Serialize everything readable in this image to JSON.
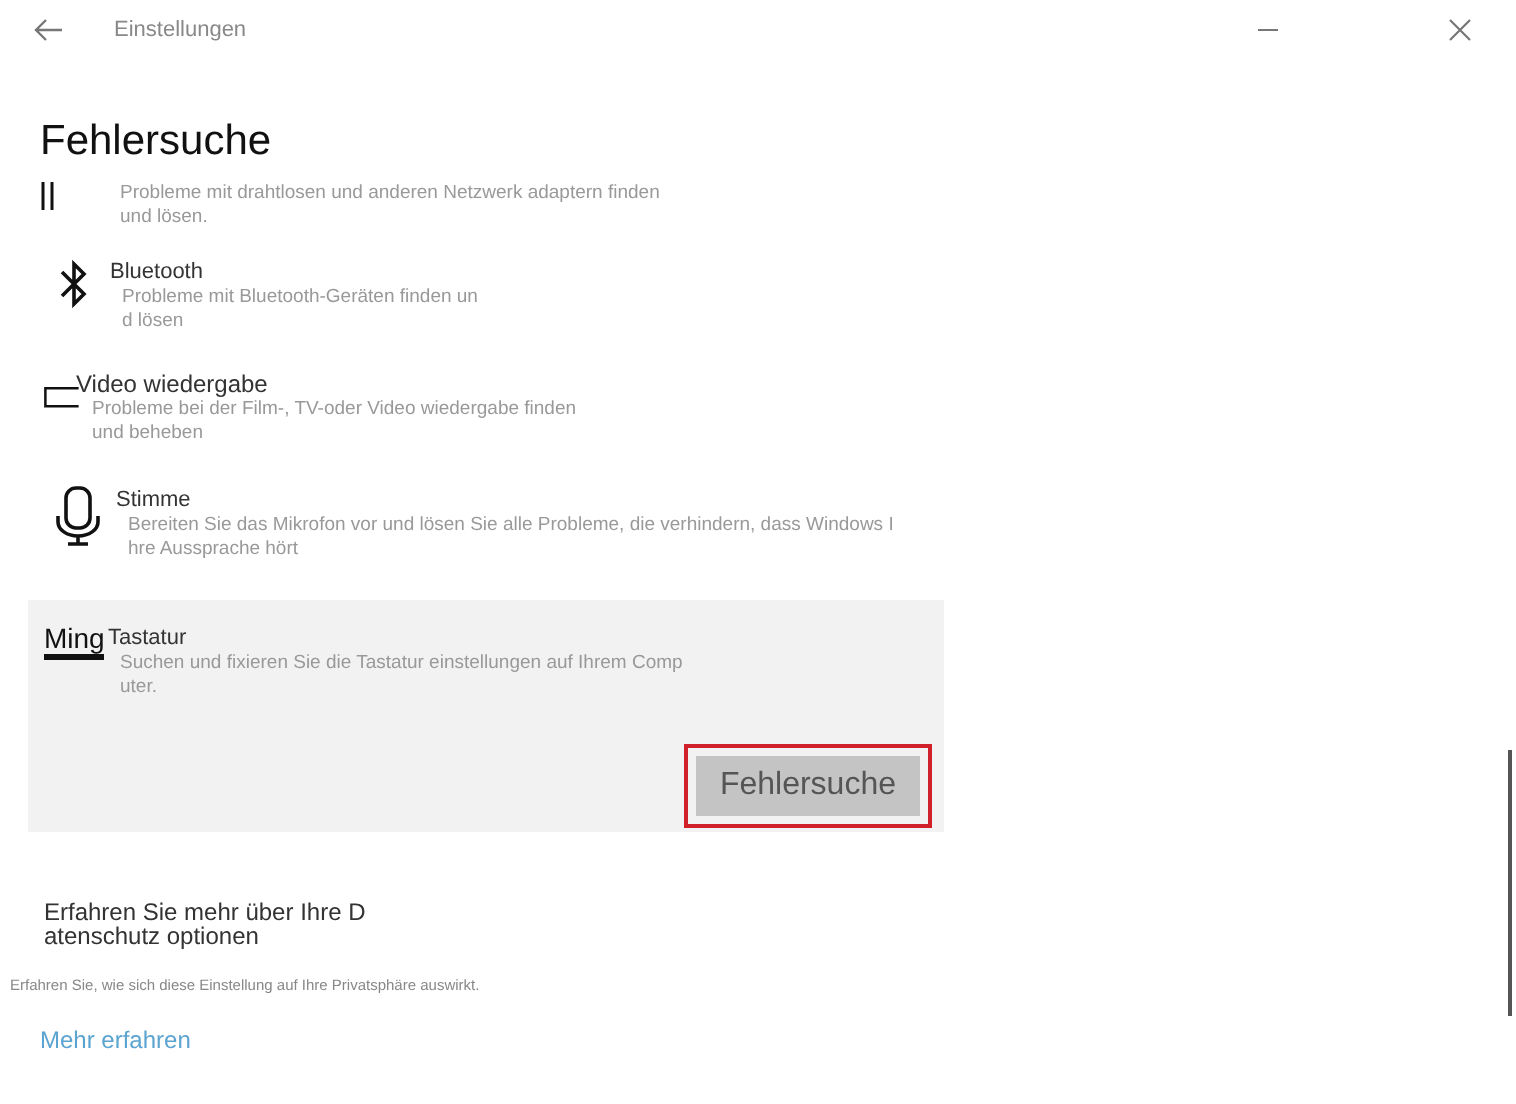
{
  "window": {
    "title": "Einstellungen"
  },
  "heading": "Fehlersuche",
  "items": [
    {
      "kind": "network",
      "description": [
        "Probleme mit drahtlosen und anderen Netzwerk adaptern finden",
        "und lösen."
      ],
      "expanded": false
    },
    {
      "kind": "bluetooth",
      "title": "Bluetooth",
      "description": [
        "Probleme mit Bluetooth-Geräten finden un",
        "d lösen"
      ],
      "expanded": false
    },
    {
      "kind": "video",
      "title": "Video wiedergabe",
      "description": [
        "Probleme bei der Film-, TV-oder Video wiedergabe finden",
        "und beheben"
      ],
      "expanded": false
    },
    {
      "kind": "microphone",
      "title": "Stimme",
      "description": [
        "Bereiten Sie das Mikrofon vor und lösen Sie alle Probleme, die verhindern, dass Windows I",
        "hre Aussprache hört"
      ],
      "expanded": false
    },
    {
      "kind": "keyboard",
      "icon_text": "Ming",
      "title": "Tastatur",
      "description": [
        "Suchen und fixieren Sie die Tastatur einstellungen auf Ihrem Comp",
        "uter."
      ],
      "expanded": true,
      "button": "Fehlersuche"
    }
  ],
  "privacy": {
    "title": [
      "Erfahren Sie mehr über Ihre D",
      "atenschutz optionen"
    ],
    "note": "Erfahren Sie, wie sich diese Einstellung auf Ihre Privatsphäre auswirkt.",
    "link": "Mehr erfahren"
  }
}
